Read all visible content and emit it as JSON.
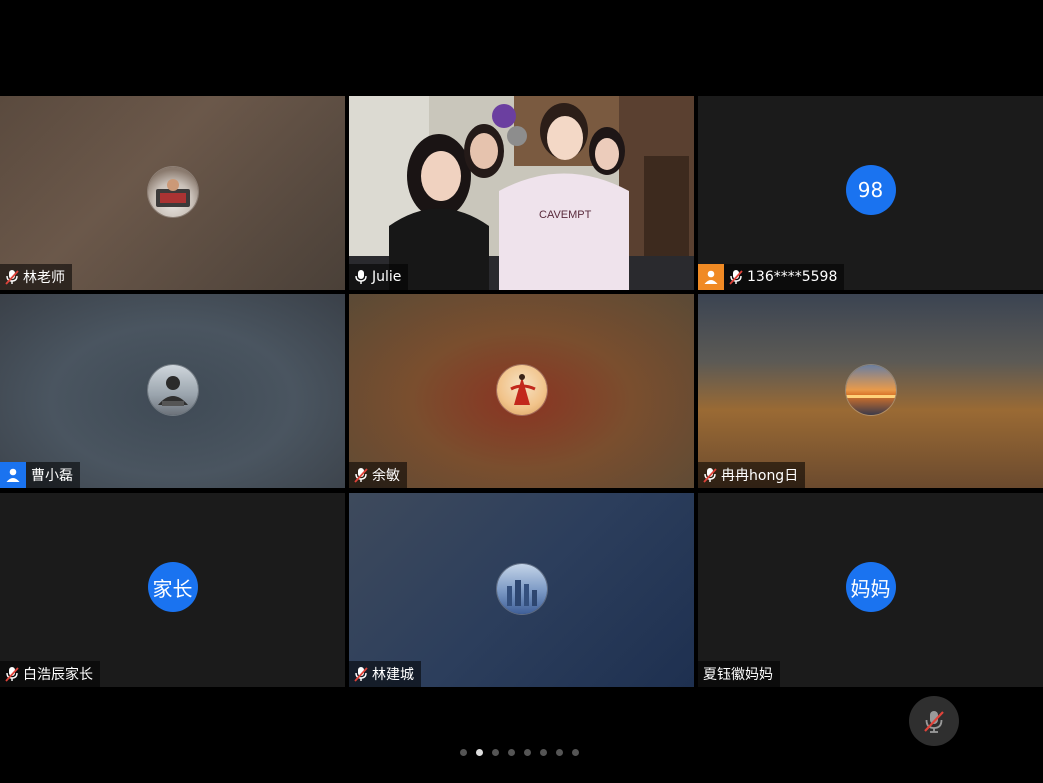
{
  "tiles": [
    {
      "name": "林老师",
      "mic": "muted",
      "badge": "none"
    },
    {
      "name": "Julie",
      "mic": "on",
      "badge": "none",
      "active": true
    },
    {
      "name": "136****5598",
      "mic": "muted",
      "badge": "user-orange",
      "initial": "98"
    },
    {
      "name": "曹小磊",
      "mic": "none",
      "badge": "user-blue"
    },
    {
      "name": "余敏",
      "mic": "muted",
      "badge": "none"
    },
    {
      "name": "冉冉hong日",
      "mic": "muted",
      "badge": "none"
    },
    {
      "name": "白浩辰家长",
      "mic": "muted",
      "badge": "none",
      "initial": "家长"
    },
    {
      "name": "林建城",
      "mic": "muted",
      "badge": "none"
    },
    {
      "name": "夏钰徽妈妈",
      "mic": "none",
      "badge": "none",
      "initial": "妈妈"
    }
  ],
  "pagination": {
    "total": 8,
    "current": 2
  },
  "colors": {
    "active_border": "#2ecc71",
    "initial_bg": "#1a73f0",
    "muted_mic": "#e0433a"
  }
}
